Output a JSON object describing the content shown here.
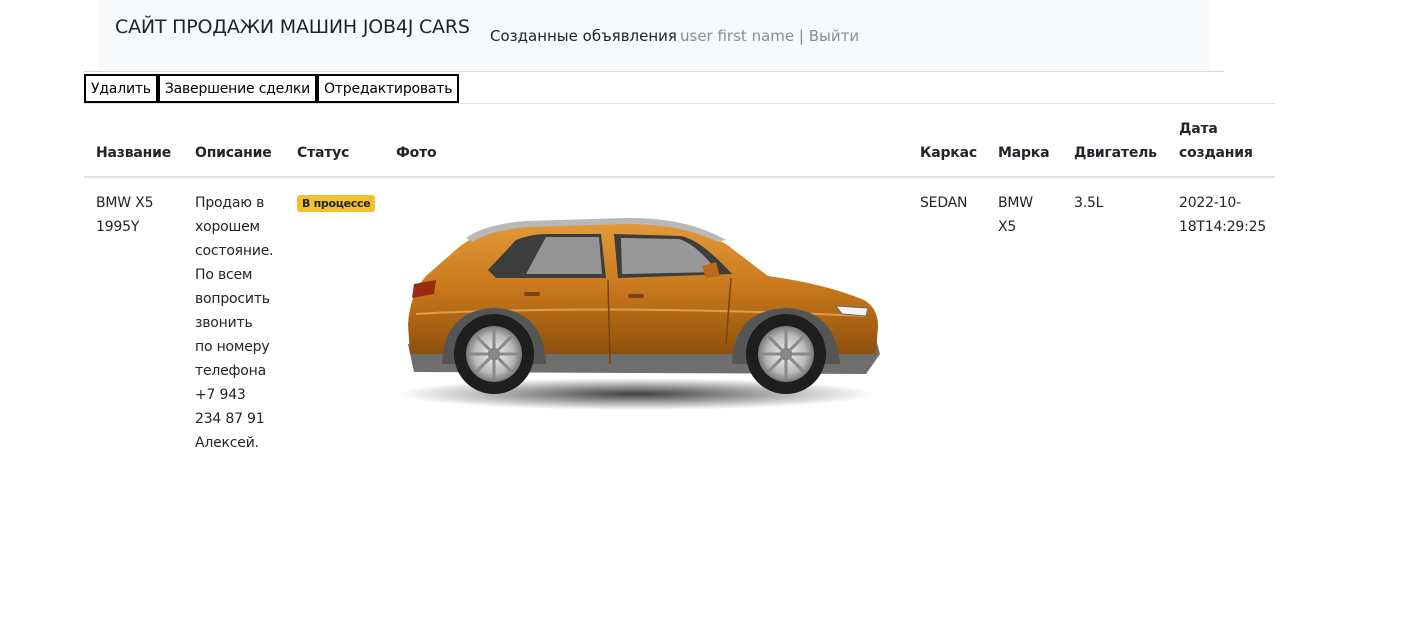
{
  "navbar": {
    "brand": "САЙТ ПРОДАЖИ МАШИН JOB4J CARS",
    "created_ads": "Созданные объявления",
    "user_name": "user first name",
    "separator": " | ",
    "logout": "Выйти"
  },
  "actions": {
    "delete": "Удалить",
    "finish": "Завершение сделки",
    "edit": "Отредактировать"
  },
  "table": {
    "headers": {
      "name": "Название",
      "description": "Описание",
      "status": "Статус",
      "photo": "Фото",
      "body": "Каркас",
      "brand": "Марка",
      "engine": "Двигатель",
      "created_line1": "Дата",
      "created_line2": "создания"
    },
    "rows": [
      {
        "name_line1": "BMW X5",
        "name_line2": "1995Y",
        "description_lines": [
          "Продаю в",
          "хорошем",
          "состояние.",
          "По всем",
          "вопросить",
          "звонить",
          "по номеру",
          "телефона",
          "+7 943",
          "234 87 91",
          "Алексей."
        ],
        "status": "В процессе",
        "body": "SEDAN",
        "brand_line1": "BMW",
        "brand_line2": "X5",
        "engine": "3.5L",
        "created_line1": "2022-10-",
        "created_line2": "18T14:29:25",
        "photo_icon": "car-photo",
        "car_color": "#c9791c"
      }
    ]
  }
}
